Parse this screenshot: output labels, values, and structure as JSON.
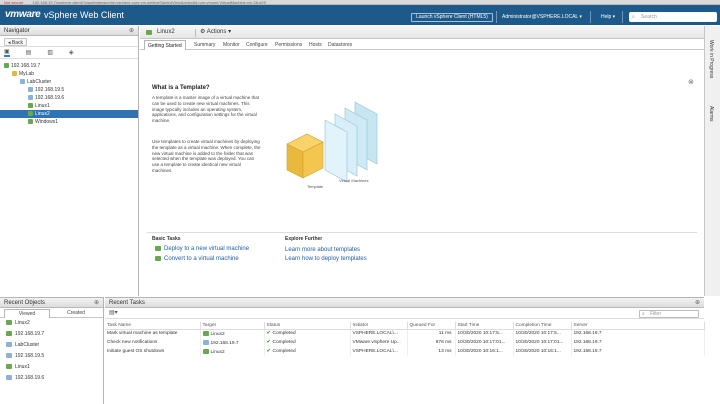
{
  "browser": {
    "security_warning": "Not secure",
    "url": "192.168.19.7/vsphere-client/?csp#extensionId=vsphere.core.vm.gettingStartedView&objectId=urn:vmomi:VirtualMachine:vm-28:d29"
  },
  "header": {
    "logo": "vmware",
    "app_title": "vSphere Web Client",
    "launch_button": "Launch vSphere Client (HTML5)",
    "user": "Administrator@VSPHERE.LOCAL",
    "help": "Help",
    "search_placeholder": "Search"
  },
  "navigator": {
    "title": "Navigator",
    "back_label": "Back",
    "tree": [
      {
        "label": "192.168.19.7",
        "depth": 0,
        "type": "vcenter"
      },
      {
        "label": "MyLab",
        "depth": 1,
        "type": "datacenter"
      },
      {
        "label": "LabCluster",
        "depth": 2,
        "type": "cluster"
      },
      {
        "label": "192.168.19.5",
        "depth": 3,
        "type": "host"
      },
      {
        "label": "192.168.19.6",
        "depth": 3,
        "type": "host"
      },
      {
        "label": "Linux1",
        "depth": 3,
        "type": "vm"
      },
      {
        "label": "Linux2",
        "depth": 3,
        "type": "vm",
        "selected": true
      },
      {
        "label": "Windows1",
        "depth": 3,
        "type": "vm"
      }
    ]
  },
  "object": {
    "name": "Linux2",
    "actions_label": "Actions"
  },
  "tabs": [
    {
      "label": "Getting Started",
      "active": true
    },
    {
      "label": "Summary"
    },
    {
      "label": "Monitor"
    },
    {
      "label": "Configure"
    },
    {
      "label": "Permissions"
    },
    {
      "label": "Hosts"
    },
    {
      "label": "Datastores"
    }
  ],
  "getting_started": {
    "title": "What is a Template?",
    "para1": "A template is a master image of a virtual machine that can be used to create new virtual machines. This image typically includes an operating system, applications, and configuration settings for the virtual machine.",
    "para2": "Use templates to create virtual machines by deploying the template as a virtual machine. When complete, the new virtual machine is added to the folder that was selected when the template was deployed. You can use a template to create identical new virtual machines.",
    "illustration_label_vms": "Virtual Machines",
    "illustration_label_template": "Template",
    "basic_tasks_title": "Basic Tasks",
    "explore_title": "Explore Further",
    "basic_tasks": [
      "Deploy to a new virtual machine",
      "Convert to a virtual machine"
    ],
    "explore_links": [
      "Learn more about templates",
      "Learn how to deploy templates"
    ]
  },
  "right_rail": [
    "Work in Progress",
    "Alarms"
  ],
  "recent_objects": {
    "title": "Recent Objects",
    "tabs": [
      "Viewed",
      "Created"
    ],
    "items": [
      {
        "label": "Linux2",
        "type": "vm"
      },
      {
        "label": "192.168.19.7",
        "type": "vcenter"
      },
      {
        "label": "LabCluster",
        "type": "cluster"
      },
      {
        "label": "192.168.19.5",
        "type": "host"
      },
      {
        "label": "Linux1",
        "type": "vm"
      },
      {
        "label": "192.168.19.6",
        "type": "host"
      }
    ]
  },
  "recent_tasks": {
    "title": "Recent Tasks",
    "filter_placeholder": "Filter",
    "columns": [
      "Task Name",
      "Target",
      "Status",
      "Initiator",
      "Queued For",
      "Start Time",
      "Completion Time",
      "Server"
    ],
    "rows": [
      {
        "task": "Mark virtual machine as template",
        "target": "Linux2",
        "target_type": "vm",
        "status": "Completed",
        "initiator": "VSPHERE.LOCAL\\...",
        "queued": "11 ms",
        "start": "10/30/2020 10:17:5...",
        "completion": "10/30/2020 10:17:5...",
        "server": "192.168.19.7"
      },
      {
        "task": "Check new notifications",
        "target": "192.168.19.7",
        "target_type": "vcenter",
        "status": "Completed",
        "initiator": "VMware vSphere Up...",
        "queued": "676 ms",
        "start": "10/30/2020 10:17:01...",
        "completion": "10/30/2020 10:17:01...",
        "server": "192.168.19.7"
      },
      {
        "task": "Initiate guest OS shutdown",
        "target": "Linux2",
        "target_type": "vm",
        "status": "Completed",
        "initiator": "VSPHERE.LOCAL\\...",
        "queued": "13 ms",
        "start": "10/30/2020 10:16:1...",
        "completion": "10/30/2020 10:16:1...",
        "server": "192.168.19.7"
      }
    ]
  },
  "colors": {
    "header_bg": "#1d5a8a",
    "selection": "#2f73b3",
    "link": "#1f5fa8",
    "success": "#4a9d2f"
  }
}
